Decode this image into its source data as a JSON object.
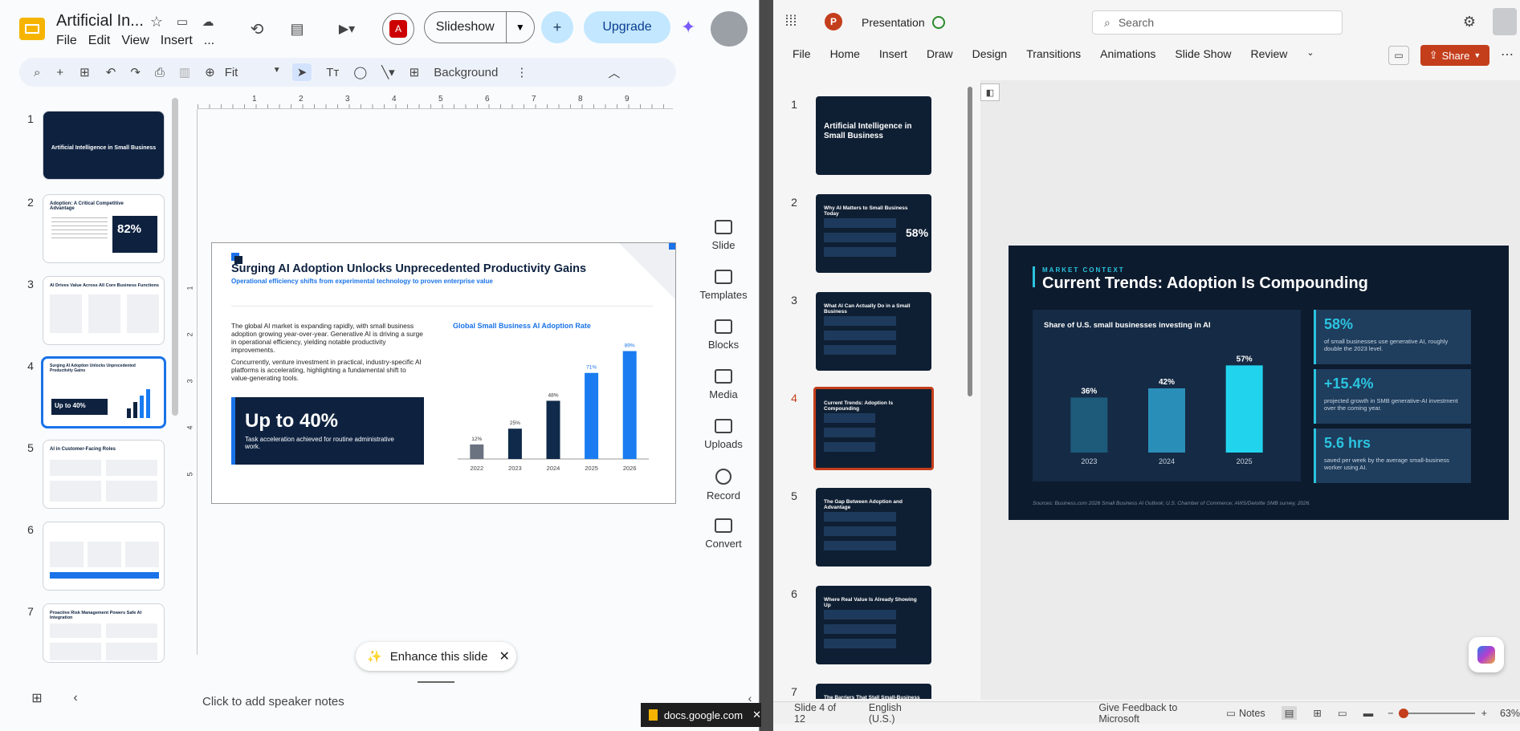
{
  "gslides": {
    "title": "Artificial In...",
    "menu": [
      "File",
      "Edit",
      "View",
      "Insert",
      "..."
    ],
    "slideshow_label": "Slideshow",
    "upgrade_label": "Upgrade",
    "toolbar": {
      "zoom": "Fit",
      "background_label": "Background"
    },
    "ruler": [
      "1",
      "2",
      "3",
      "4",
      "5",
      "6",
      "7",
      "8",
      "9"
    ],
    "vruler": [
      "1",
      "2",
      "3",
      "4",
      "5"
    ],
    "thumbnails": [
      {
        "num": "1",
        "title": "Artificial Intelligence in Small Business"
      },
      {
        "num": "2",
        "title": "Adoption: A Critical Competitive Advantage",
        "stat": "82%"
      },
      {
        "num": "3",
        "title": "AI Drives Value Across All Core Business Functions"
      },
      {
        "num": "4",
        "title": "Surging AI Adoption Unlocks Unprecedented Productivity Gains",
        "stat": "Up to 40%"
      },
      {
        "num": "5",
        "title": "AI in Customer-Facing Roles"
      },
      {
        "num": "6",
        "title": ""
      },
      {
        "num": "7",
        "title": "Proactive Risk Management Powers Safe AI Integration"
      }
    ],
    "slide": {
      "title": "Surging AI Adoption Unlocks Unprecedented Productivity Gains",
      "subtitle": "Operational efficiency shifts from experimental technology to proven enterprise value",
      "para1": "The global AI market is expanding rapidly, with small business adoption growing year-over-year. Generative AI is driving a surge in operational efficiency, yielding notable productivity improvements.",
      "para2": "Concurrently, venture investment in practical, industry-specific AI platforms is accelerating, highlighting a fundamental shift to value-generating tools.",
      "callout_value": "Up to 40%",
      "callout_text": "Task acceleration achieved for routine administrative work.",
      "chart_title": "Global Small Business AI Adoption Rate"
    },
    "side_tools": [
      "Slide",
      "Templates",
      "Blocks",
      "Media",
      "Uploads",
      "Record",
      "Convert"
    ],
    "enhance_label": "Enhance this slide",
    "speaker_notes": "Click to add speaker notes",
    "download_chip": "docs.google.com"
  },
  "chart_data": [
    {
      "type": "bar",
      "title": "Global Small Business AI Adoption Rate",
      "categories": [
        "2022",
        "2023",
        "2024",
        "2025",
        "2026"
      ],
      "values": [
        12,
        25,
        48,
        71,
        89
      ],
      "labels": [
        "12%",
        "25%",
        "48%",
        "71%",
        "89%"
      ],
      "colors": [
        "#6b7280",
        "#0f2a4a",
        "#0f2a4a",
        "#1a7cf0",
        "#1a7cf0"
      ]
    },
    {
      "type": "bar",
      "title": "Share of U.S. small businesses investing in AI",
      "categories": [
        "2023",
        "2024",
        "2025"
      ],
      "values": [
        36,
        42,
        57
      ],
      "labels": [
        "36%",
        "42%",
        "57%"
      ],
      "colors": [
        "#1e5a7a",
        "#2a8fb8",
        "#22d3ee"
      ]
    }
  ],
  "ppt": {
    "app_title": "Presentation",
    "search_placeholder": "Search",
    "menu": [
      "File",
      "Home",
      "Insert",
      "Draw",
      "Design",
      "Transitions",
      "Animations",
      "Slide Show",
      "Review"
    ],
    "share_label": "Share",
    "thumbnails": [
      {
        "num": "1",
        "title": "Artificial Intelligence in Small Business"
      },
      {
        "num": "2",
        "title": "Why AI Matters to Small Business Today",
        "stat": "58%"
      },
      {
        "num": "3",
        "title": "What AI Can Actually Do in a Small Business"
      },
      {
        "num": "4",
        "title": "Current Trends: Adoption Is Compounding"
      },
      {
        "num": "5",
        "title": "The Gap Between Adoption and Advantage"
      },
      {
        "num": "6",
        "title": "Where Real Value Is Already Showing Up"
      },
      {
        "num": "7",
        "title": "The Barriers That Stall Small-Business AI"
      }
    ],
    "slide": {
      "kicker": "MARKET CONTEXT",
      "title": "Current Trends: Adoption Is Compounding",
      "chart_title": "Share of U.S. small businesses investing in AI",
      "stats": [
        {
          "value": "58%",
          "desc": "of small businesses use generative AI, roughly double the 2023 level."
        },
        {
          "value": "+15.4%",
          "desc": "projected growth in SMB generative-AI investment over the coming year."
        },
        {
          "value": "5.6 hrs",
          "desc": "saved per week by the average small-business worker using AI."
        }
      ],
      "sources": "Sources: Business.com 2026 Small Business AI Outlook; U.S. Chamber of Commerce; AWS/Deloitte SMB survey, 2026."
    },
    "status": {
      "slide_pos": "Slide 4 of 12",
      "lang": "English (U.S.)",
      "feedback": "Give Feedback to Microsoft",
      "notes": "Notes",
      "zoom": "63%"
    }
  }
}
